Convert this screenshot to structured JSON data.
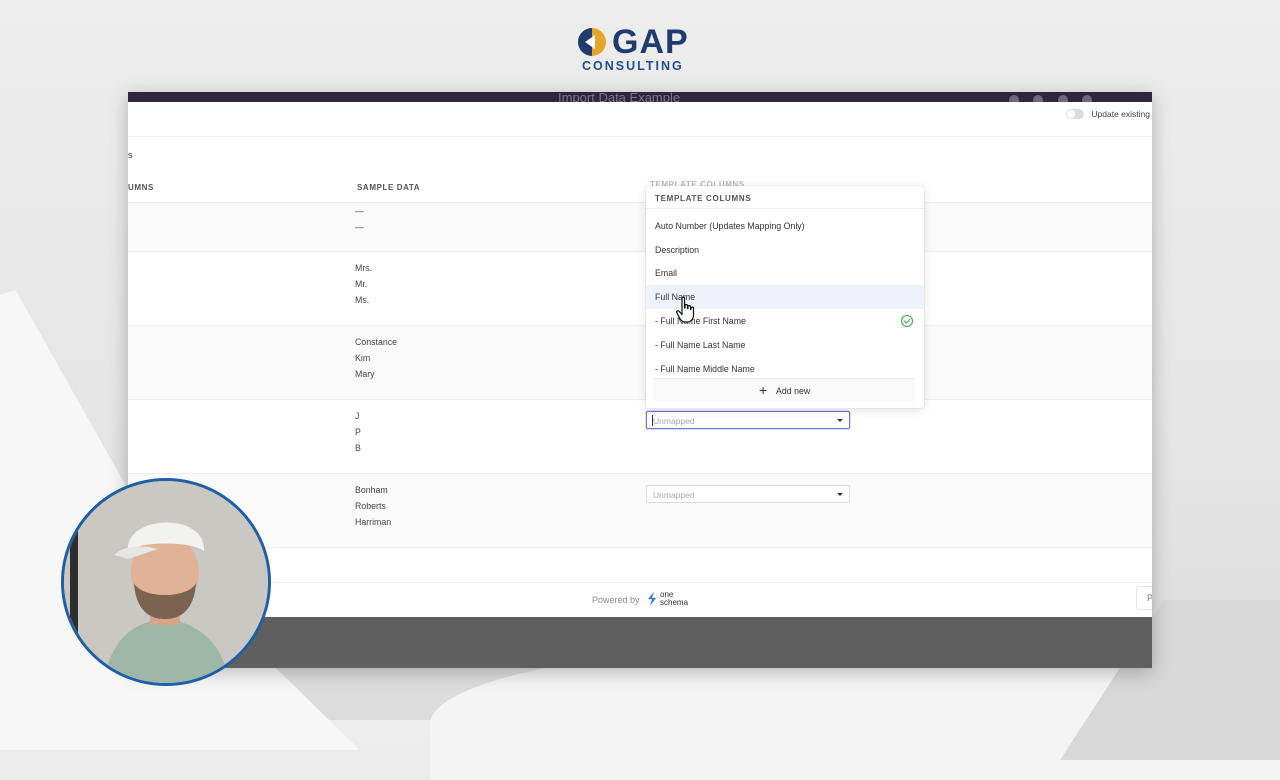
{
  "logo": {
    "main": "GAP",
    "sub": "CONSULTING"
  },
  "app": {
    "title": "Import Data Example",
    "toolbar": {
      "toggle_label": "Update existing"
    },
    "section_label": "s",
    "columns": {
      "left": "UMNS",
      "sample": "SAMPLE DATA",
      "template": "TEMPLATE COLUMNS"
    },
    "rows": [
      {
        "samples": [
          "—",
          "—"
        ]
      },
      {
        "samples": [
          "Mrs.",
          "Mr.",
          "Ms."
        ]
      },
      {
        "samples": [
          "Constance",
          "Kim",
          "Mary"
        ]
      },
      {
        "samples": [
          "J",
          "P",
          "B"
        ],
        "select": "Unmapped"
      },
      {
        "samples": [
          "Bonham",
          "Roberts",
          "Harriman"
        ],
        "select": "Unmapped"
      }
    ],
    "dropdown": {
      "header": "TEMPLATE COLUMNS",
      "items": [
        "Auto Number (Updates Mapping Only)",
        "Description",
        "Email",
        "Full Name",
        "- Full Name First Name",
        "- Full Name Last Name",
        "- Full Name Middle Name"
      ],
      "add_new": "Add new"
    },
    "footer": {
      "powered_by": "Powered by",
      "brand_line1": "one",
      "brand_line2": "schema",
      "side_button": "P"
    }
  },
  "colors": {
    "topbar": "#2e2540",
    "accent": "#6f77d6",
    "check": "#2faa4f",
    "logo_blue": "#1e3c6e",
    "webcam_ring": "#1e5fa6"
  }
}
